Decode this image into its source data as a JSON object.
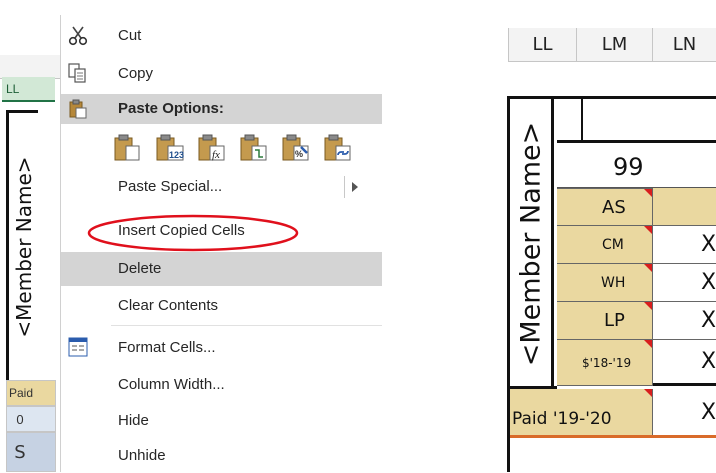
{
  "left_sheet": {
    "col_header": "LL",
    "member_name": "<Member Name>",
    "paid_label": "Paid",
    "zero_value": "0",
    "s_value": "S"
  },
  "context_menu": {
    "items": {
      "cut": "Cut",
      "copy": "Copy",
      "paste_options": "Paste Options:",
      "paste_special": "Paste Special...",
      "insert_copied_cells": "Insert Copied Cells",
      "delete": "Delete",
      "clear_contents": "Clear Contents",
      "format_cells": "Format Cells...",
      "column_width": "Column Width...",
      "hide": "Hide",
      "unhide": "Unhide"
    },
    "paste_icons": [
      "paste-icon",
      "paste-values-icon",
      "paste-formulas-icon",
      "paste-transpose-icon",
      "paste-formatting-icon",
      "paste-link-icon"
    ],
    "highlight_color": "#e0101c"
  },
  "right_sheet": {
    "col_headers": [
      "LL",
      "LM",
      "LN"
    ],
    "member_name": "<Member Name>",
    "number": "99",
    "rows": [
      {
        "code": "AS",
        "mark": ""
      },
      {
        "code": "CM",
        "mark": "X"
      },
      {
        "code": "WH",
        "mark": "X"
      },
      {
        "code": "LP",
        "mark": "X"
      },
      {
        "code": "$'18-'19",
        "mark": "X"
      }
    ],
    "paid_row": {
      "label": "Paid '19-'20",
      "mark": "X"
    },
    "tan_color": "#ead8a0",
    "flag_color": "#d81e1e"
  }
}
